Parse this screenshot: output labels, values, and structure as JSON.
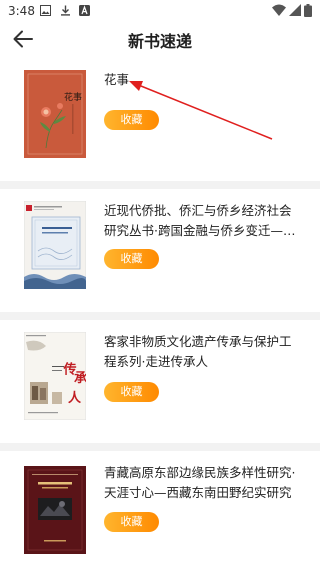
{
  "status_bar": {
    "time": "3:48",
    "icons": [
      "image-icon",
      "download-icon",
      "a-icon"
    ],
    "right_icons": [
      "wifi-icon",
      "signal-icon",
      "battery-icon"
    ]
  },
  "header": {
    "title": "新书速递",
    "back_icon": "arrow-left-icon"
  },
  "books": [
    {
      "title": "花事",
      "button": "收藏",
      "cover_text": "花事"
    },
    {
      "title": "近现代侨批、侨汇与侨乡经济社会研究丛书·跨国金融与侨乡变迁—民国...",
      "button": "收藏"
    },
    {
      "title": "客家非物质文化遗产传承与保护工程系列·走进传承人",
      "button": "收藏",
      "cover_text": "传承人"
    },
    {
      "title": "青藏高原东部边缘民族多样性研究·天涯寸心—西藏东南田野纪实研究",
      "button": "收藏"
    }
  ],
  "colors": {
    "accent": "#ff9500",
    "annotation_arrow": "#e0201f",
    "divider": "#f2f2f2"
  }
}
